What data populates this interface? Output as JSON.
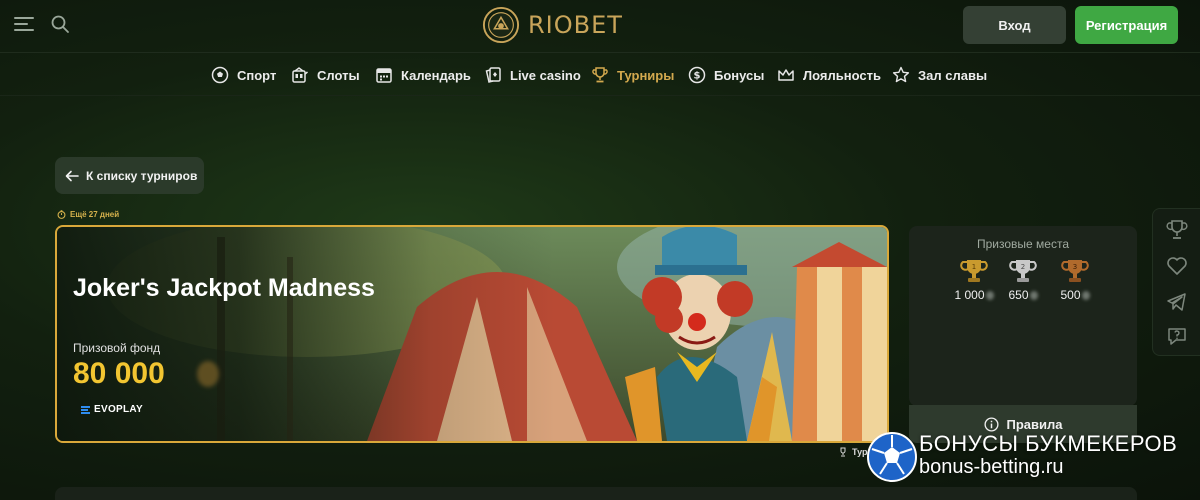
{
  "header": {
    "menu_icon": "hamburger-icon",
    "search_icon": "search-icon",
    "logo_text": "RIOBET",
    "login_label": "Вход",
    "register_label": "Регистрация"
  },
  "nav": {
    "items": [
      {
        "label": "Спорт",
        "icon": "soccer-ball-icon"
      },
      {
        "label": "Слоты",
        "icon": "slot-machine-icon"
      },
      {
        "label": "Календарь",
        "icon": "calendar-icon"
      },
      {
        "label": "Live casino",
        "icon": "cards-icon"
      },
      {
        "label": "Турниры",
        "icon": "trophy-icon",
        "active": true
      },
      {
        "label": "Бонусы",
        "icon": "coin-icon"
      },
      {
        "label": "Лояльность",
        "icon": "crown-icon"
      },
      {
        "label": "Зал славы",
        "icon": "star-icon"
      }
    ],
    "active_color": "#d3a94e"
  },
  "back_label": "К списку турниров",
  "timer_text": "Ещё 27 дней",
  "tournament": {
    "title": "Joker's Jackpot Madness",
    "prize_fund_label": "Призовой фонд",
    "prize_fund_value": "80 000",
    "provider": "EVOPLAY"
  },
  "prizes": {
    "title": "Призовые места",
    "places": [
      {
        "rank": "1",
        "amount": "1 000",
        "color": "#c99a2e"
      },
      {
        "rank": "2",
        "amount": "650",
        "color": "#c8c8c8"
      },
      {
        "rank": "3",
        "amount": "500",
        "color": "#b06a2c"
      }
    ]
  },
  "rules_label": "Правила",
  "breadcrumb_label": "Турниры",
  "rail_icons": [
    "trophy-icon",
    "heart-icon",
    "telegram-icon",
    "chat-question-icon"
  ],
  "watermark": {
    "line1": "БОНУСЫ БУКМЕКЕРОВ",
    "line2": "bonus-betting.ru"
  },
  "colors": {
    "accent_gold": "#d9a83a",
    "register_green": "#3fa843",
    "prize_gold": "#f2c531"
  }
}
